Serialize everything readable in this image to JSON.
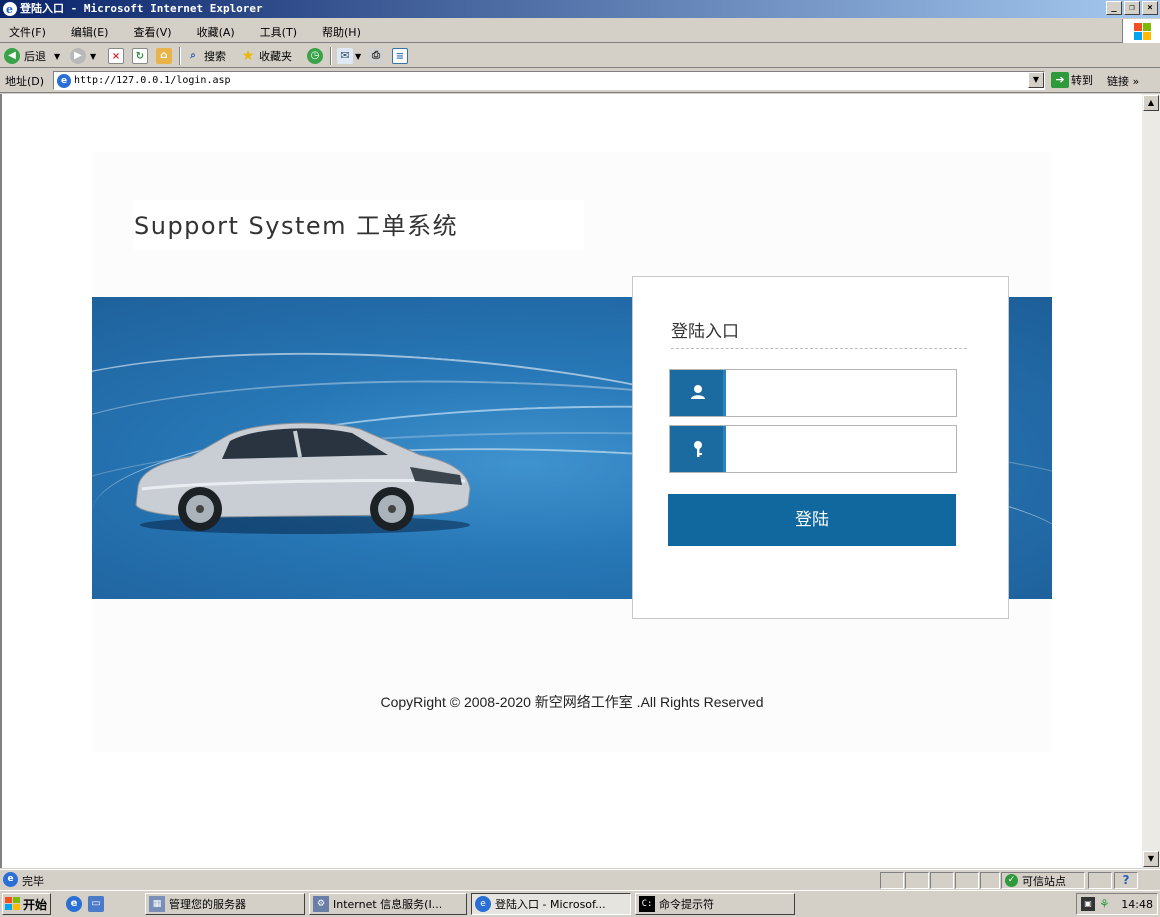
{
  "window": {
    "title": "登陆入口 - Microsoft Internet Explorer",
    "buttons": [
      "_",
      "❐",
      "×"
    ]
  },
  "menu": {
    "items": [
      "文件(F)",
      "编辑(E)",
      "查看(V)",
      "收藏(A)",
      "工具(T)",
      "帮助(H)"
    ]
  },
  "toolbar": {
    "back_label": "后退",
    "search_label": "搜索",
    "favorites_label": "收藏夹"
  },
  "address": {
    "label": "地址(D)",
    "url": "http://127.0.0.1/login.asp",
    "go_label": "转到",
    "links_label": "链接"
  },
  "page": {
    "brand_title": "Support System 工单系统",
    "login_title": "登陆入口",
    "username_value": "",
    "password_value": "",
    "login_button": "登陆",
    "copyright": "CopyRight © 2008-2020 新空网络工作室 .All Rights Reserved"
  },
  "status": {
    "text": "完毕",
    "zone": "可信站点"
  },
  "taskbar": {
    "start_label": "开始",
    "tasks": [
      {
        "label": "管理您的服务器",
        "active": false
      },
      {
        "label": "Internet 信息服务(I...",
        "active": false
      },
      {
        "label": "登陆入口 - Microsof...",
        "active": true
      },
      {
        "label": "命令提示符",
        "active": false
      }
    ],
    "clock": "14:48"
  },
  "colors": {
    "banner_blue": "#2777b6",
    "button_blue": "#11689f",
    "icon_blue": "#1b6aa0"
  }
}
